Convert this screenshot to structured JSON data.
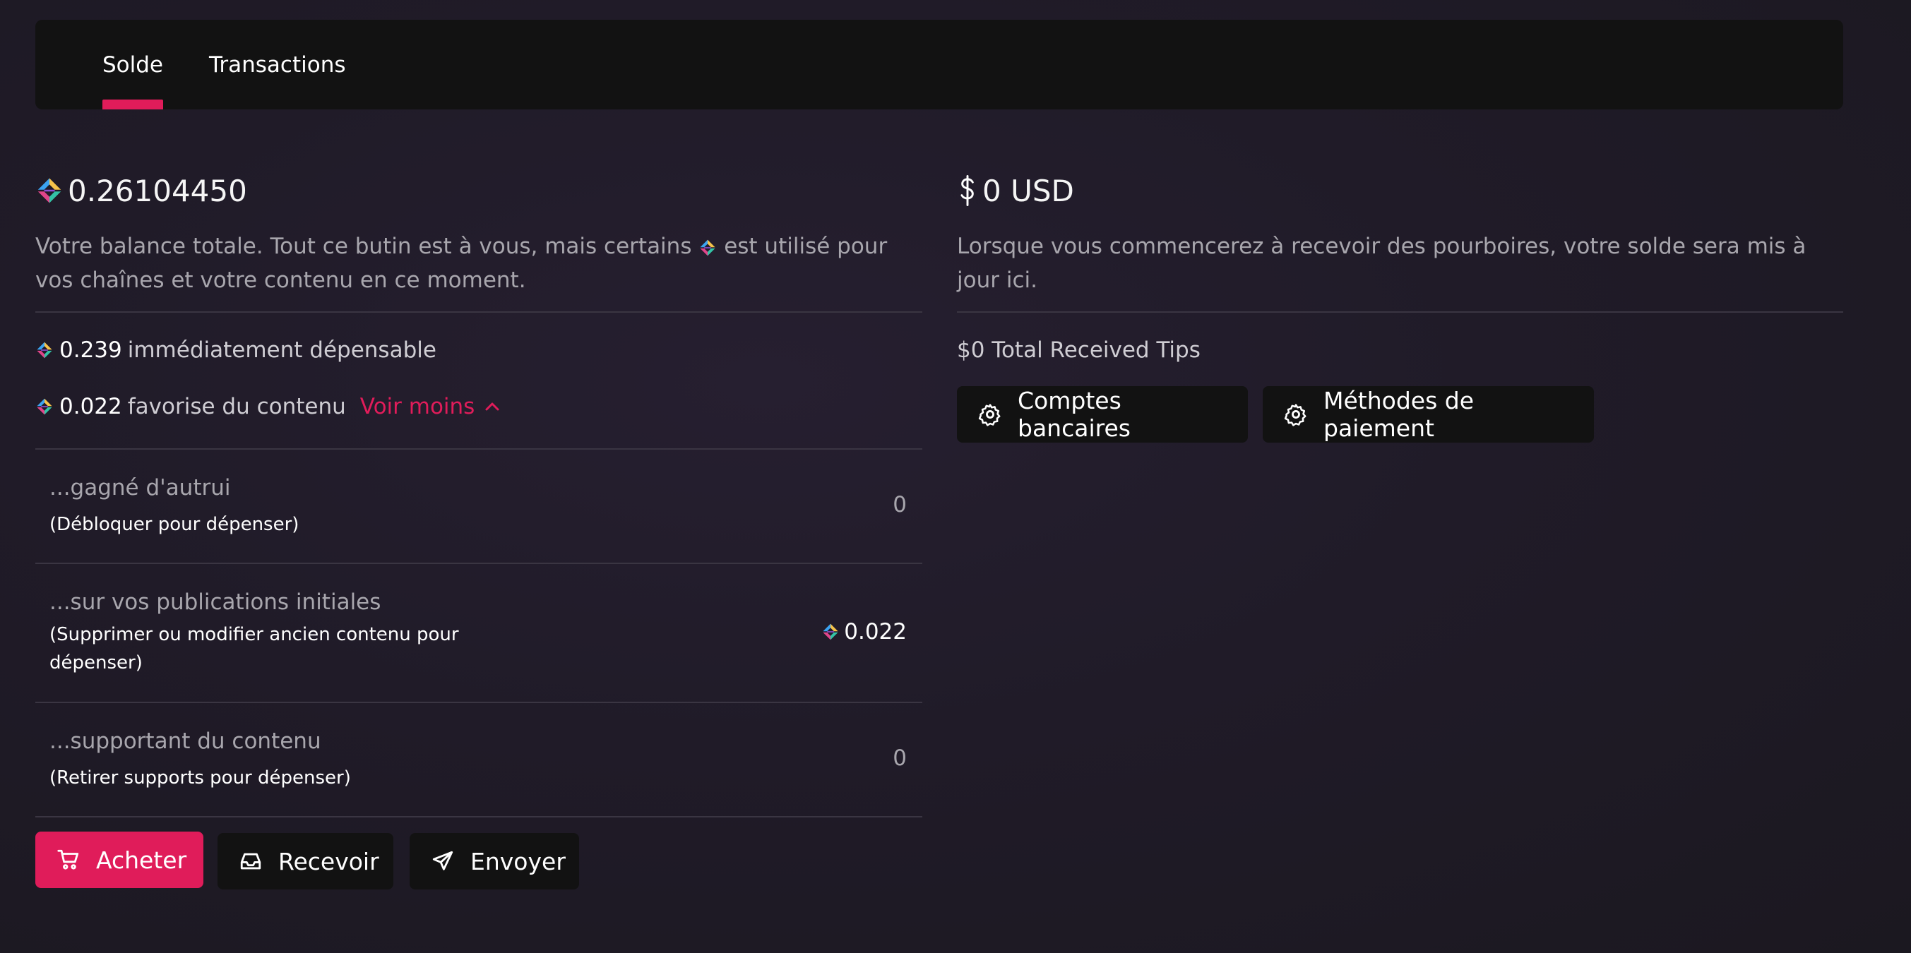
{
  "tabs": [
    {
      "label": "Solde",
      "active": true
    },
    {
      "label": "Transactions",
      "active": false
    }
  ],
  "colors": {
    "accent": "#e01c5a",
    "background": "#201b28",
    "panel": "#121212"
  },
  "left": {
    "total_amount": "0.26104450",
    "description_part1": "Votre balance totale. Tout ce butin est à vous, mais certains",
    "description_part2": "est utilisé pour vos chaînes et votre contenu en ce moment.",
    "spendable_amount": "0.239",
    "spendable_label": "immédiatement dépensable",
    "boosting_amount": "0.022",
    "boosting_label": "favorise du contenu",
    "see_less_label": "Voir moins",
    "rows": [
      {
        "title": "...gagné d'autrui",
        "subtitle": "(Débloquer pour dépenser)",
        "value": "0"
      },
      {
        "title": "...sur vos publications initiales",
        "subtitle": "(Supprimer ou modifier ancien contenu pour dépenser)",
        "value": "0.022"
      },
      {
        "title": "...supportant du contenu",
        "subtitle": "(Retirer supports pour dépenser)",
        "value": "0"
      }
    ],
    "buttons": {
      "buy": "Acheter",
      "receive": "Recevoir",
      "send": "Envoyer"
    }
  },
  "right": {
    "usd_amount": "0 USD",
    "description": "Lorsque vous commencerez à recevoir des pourboires, votre solde sera mis à jour ici.",
    "total_tips": "$0 Total Received Tips",
    "buttons": {
      "bank_accounts": "Comptes bancaires",
      "payment_methods": "Méthodes de paiement"
    }
  },
  "icons": [
    "lbc-credit-icon",
    "dollar-icon",
    "chevron-up-icon",
    "cart-icon",
    "inbox-icon",
    "send-icon",
    "gear-icon"
  ]
}
